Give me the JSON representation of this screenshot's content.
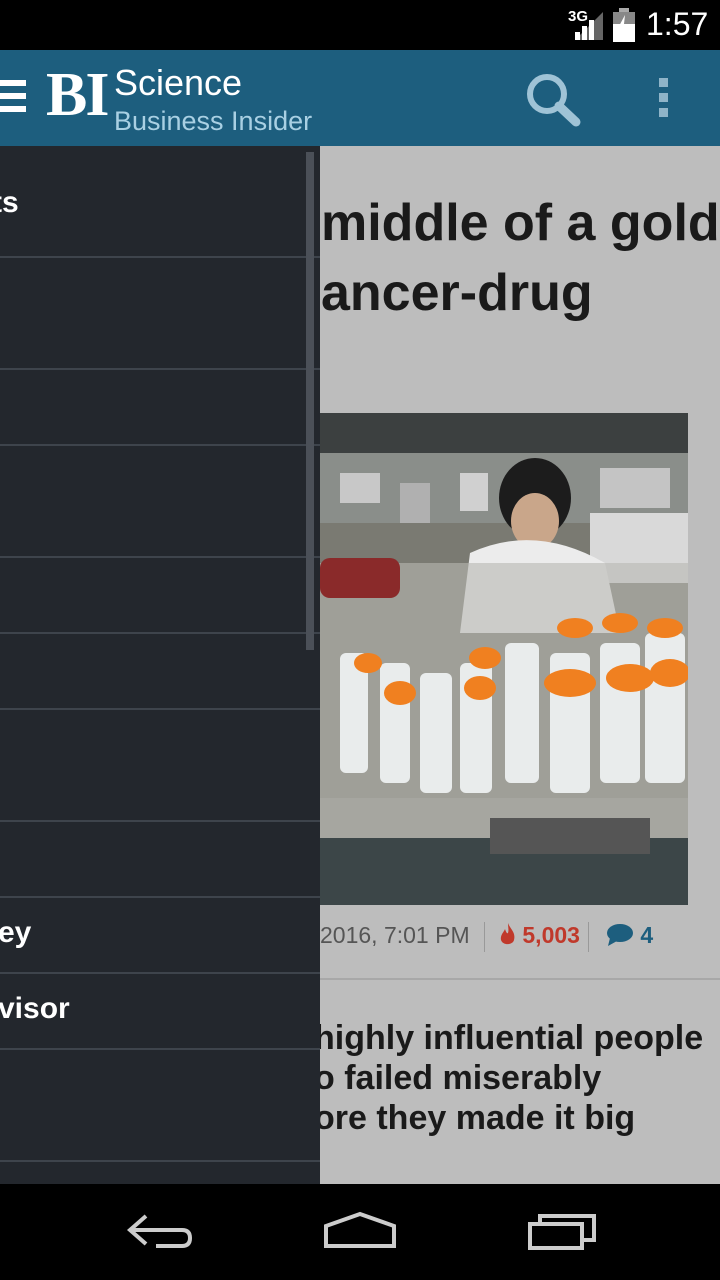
{
  "status_bar": {
    "network": "3G",
    "time": "1:57"
  },
  "app_bar": {
    "logo": "BI",
    "title": "Science",
    "subtitle": "Business Insider"
  },
  "drawer": {
    "items": [
      {
        "label": "ts"
      },
      {
        "label": ""
      },
      {
        "label": ""
      },
      {
        "label": ""
      },
      {
        "label": ""
      },
      {
        "label": ""
      },
      {
        "label": ""
      },
      {
        "label": ""
      },
      {
        "label": "ey"
      },
      {
        "label": "visor"
      },
      {
        "label": ""
      },
      {
        "label": ""
      }
    ]
  },
  "article1": {
    "headline_line1": "middle of a gold",
    "headline_line2": "ancer-drug",
    "date": "2016, 7:01 PM",
    "views": "5,003",
    "comments": "4"
  },
  "article2": {
    "headline_line1": "highly influential people",
    "headline_line2": "o failed miserably",
    "headline_line3": "ore they made it big"
  },
  "icons": {
    "menu": "menu-icon",
    "search": "search-icon",
    "overflow": "overflow-menu-icon",
    "fire": "fire-icon",
    "comment": "comment-icon",
    "back": "back-icon",
    "home": "home-icon",
    "recents": "recents-icon"
  }
}
